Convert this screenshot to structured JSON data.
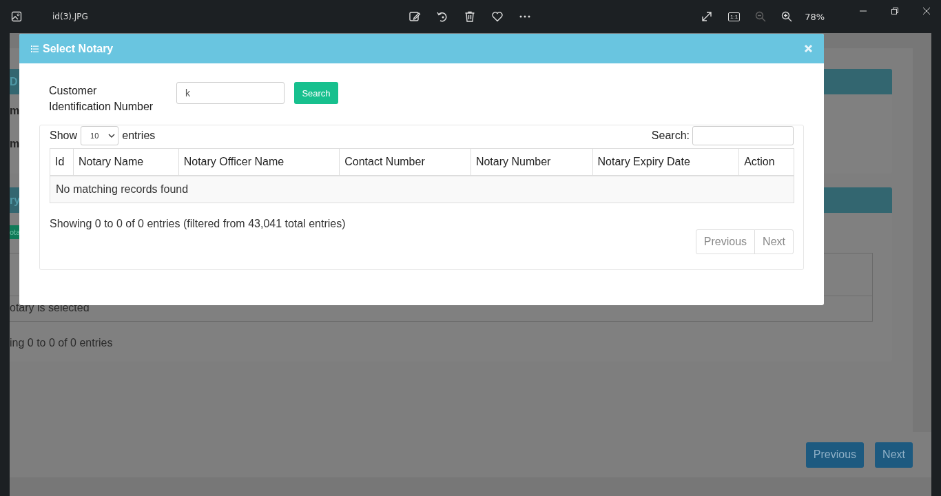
{
  "viewer": {
    "file_name": "id(3).JPG",
    "actual_size_label": "1:1",
    "zoom_level": "78%"
  },
  "background_page": {
    "card_1": {
      "header": "D",
      "fields": [
        "m",
        "m"
      ]
    },
    "card_2": {
      "header": "ry",
      "button": "ota",
      "table_message": "otary is selected",
      "table_info": "ing 0 to 0 of 0 entries"
    },
    "buttons": [
      "Previous",
      "Next"
    ]
  },
  "modal": {
    "title": "Select Notary",
    "customer_id_label": "Customer Identification Number",
    "customer_id_value": "k",
    "search_button": "Search",
    "table": {
      "show_label": "Show",
      "page_length": "10",
      "entries_label": "entries",
      "search_label": "Search:",
      "columns": [
        "Id",
        "Notary Name",
        "Notary Officer Name",
        "Contact Number",
        "Notary Number",
        "Notary Expiry Date",
        "Action"
      ],
      "empty_message": "No matching records found",
      "info": "Showing 0 to 0 of 0 entries (filtered from 43,041 total entries)",
      "pagination": [
        {
          "label": "Previous",
          "disabled": true
        },
        {
          "label": "Next",
          "disabled": true
        }
      ]
    }
  }
}
